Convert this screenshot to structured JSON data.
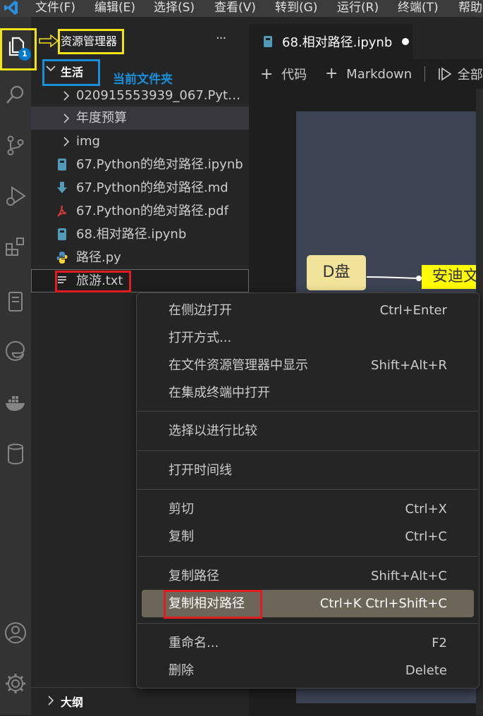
{
  "menubar": [
    "文件(F)",
    "编辑(E)",
    "选择(S)",
    "查看(V)",
    "转到(G)",
    "运行(R)",
    "终端(T)",
    "帮助"
  ],
  "activity": {
    "explorer_badge": "1"
  },
  "sidebar": {
    "header_title": "资源管理器",
    "more_label": "···",
    "folder_name": "生活",
    "annotation_current_folder": "当前文件夹",
    "items": [
      {
        "label": "020915553939_067.Pytho...",
        "type": "folder"
      },
      {
        "label": "年度预算",
        "type": "folder"
      },
      {
        "label": "img",
        "type": "folder"
      },
      {
        "label": "67.Python的绝对路径.ipynb",
        "type": "notebook"
      },
      {
        "label": "67.Python的绝对路径.md",
        "type": "markdown"
      },
      {
        "label": "67.Python的绝对路径.pdf",
        "type": "pdf"
      },
      {
        "label": "68.相对路径.ipynb",
        "type": "notebook"
      },
      {
        "label": "路径.py",
        "type": "python"
      },
      {
        "label": "旅游.txt",
        "type": "text"
      }
    ],
    "outline_label": "大纲"
  },
  "editor": {
    "tab_title": "68.相对路径.ipynb",
    "toolbar": {
      "code_label": "代码",
      "markdown_label": "Markdown",
      "run_all_label": "全部"
    },
    "mindmap": {
      "node_d": "D盘",
      "node_andy": "安迪文"
    }
  },
  "context_menu": {
    "groups": [
      [
        {
          "label": "在侧边打开",
          "shortcut": "Ctrl+Enter"
        },
        {
          "label": "打开方式...",
          "shortcut": ""
        },
        {
          "label": "在文件资源管理器中显示",
          "shortcut": "Shift+Alt+R"
        },
        {
          "label": "在集成终端中打开",
          "shortcut": ""
        }
      ],
      [
        {
          "label": "选择以进行比较",
          "shortcut": ""
        }
      ],
      [
        {
          "label": "打开时间线",
          "shortcut": ""
        }
      ],
      [
        {
          "label": "剪切",
          "shortcut": "Ctrl+X"
        },
        {
          "label": "复制",
          "shortcut": "Ctrl+C"
        }
      ],
      [
        {
          "label": "复制路径",
          "shortcut": "Shift+Alt+C"
        },
        {
          "label": "复制相对路径",
          "shortcut": "Ctrl+K Ctrl+Shift+C"
        }
      ],
      [
        {
          "label": "重命名...",
          "shortcut": "F2"
        },
        {
          "label": "删除",
          "shortcut": "Delete"
        }
      ]
    ]
  },
  "colors": {
    "accent_blue": "#007acc",
    "highlight_red": "#e21c23",
    "highlight_yellow": "#f2e314",
    "highlight_blue": "#1a8fd8",
    "mindmap_node": "#f1e39a",
    "mindmap_node_yellow": "#fffb00"
  }
}
